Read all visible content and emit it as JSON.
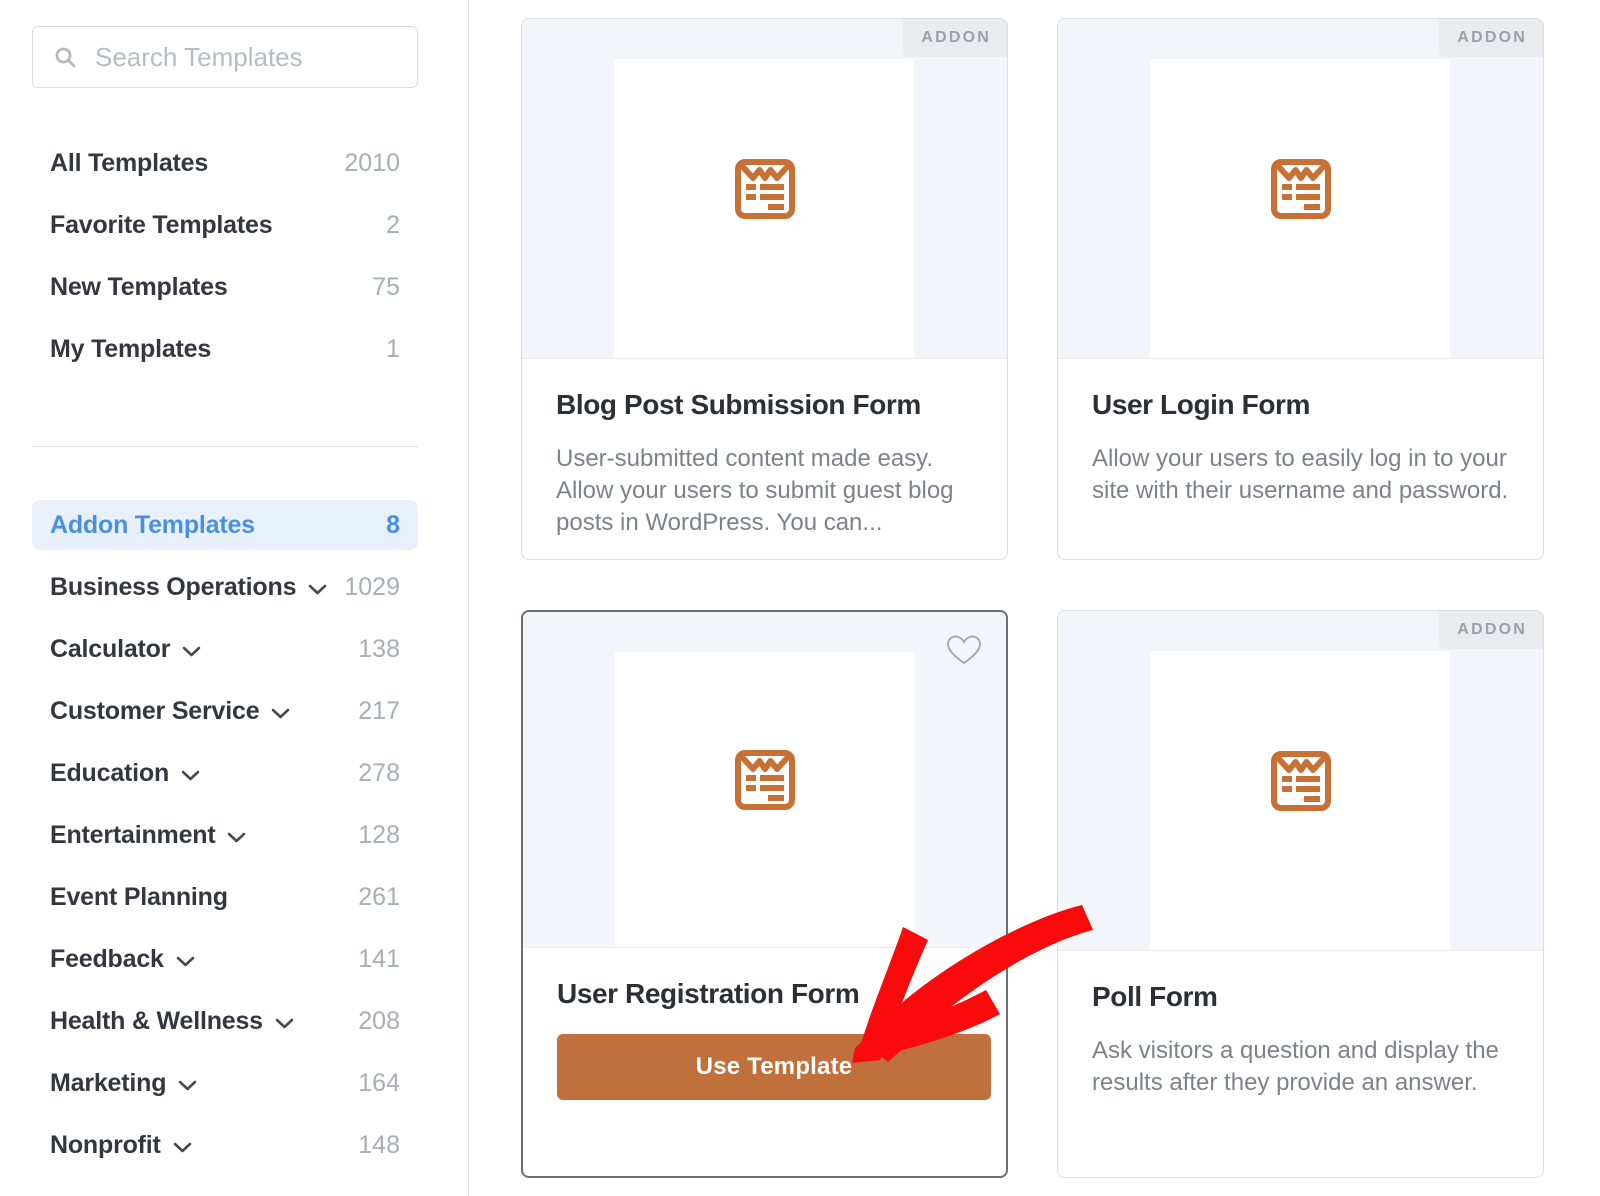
{
  "sidebar": {
    "search": {
      "placeholder": "Search Templates",
      "value": "",
      "icon": "search-icon"
    },
    "nav": [
      {
        "label": "All Templates",
        "count": "2010"
      },
      {
        "label": "Favorite Templates",
        "count": "2"
      },
      {
        "label": "New Templates",
        "count": "75"
      },
      {
        "label": "My Templates",
        "count": "1"
      }
    ],
    "categories": [
      {
        "label": "Addon Templates",
        "count": "8",
        "chevron": false,
        "active": true
      },
      {
        "label": "Business Operations",
        "count": "1029",
        "chevron": true,
        "active": false
      },
      {
        "label": "Calculator",
        "count": "138",
        "chevron": true,
        "active": false
      },
      {
        "label": "Customer Service",
        "count": "217",
        "chevron": true,
        "active": false
      },
      {
        "label": "Education",
        "count": "278",
        "chevron": true,
        "active": false
      },
      {
        "label": "Entertainment",
        "count": "128",
        "chevron": true,
        "active": false
      },
      {
        "label": "Event Planning",
        "count": "261",
        "chevron": false,
        "active": false
      },
      {
        "label": "Feedback",
        "count": "141",
        "chevron": true,
        "active": false
      },
      {
        "label": "Health & Wellness",
        "count": "208",
        "chevron": true,
        "active": false
      },
      {
        "label": "Marketing",
        "count": "164",
        "chevron": true,
        "active": false
      },
      {
        "label": "Nonprofit",
        "count": "148",
        "chevron": true,
        "active": false
      }
    ]
  },
  "templates": [
    {
      "title": "Blog Post Submission Form",
      "description": "User-submitted content made easy. Allow your users to submit guest blog posts in WordPress. You can...",
      "badge": "ADDON",
      "has_badge": true,
      "favorited": false,
      "selected": false,
      "icon": "form-document-icon"
    },
    {
      "title": "User Login Form",
      "description": "Allow your users to easily log in to your site with their username and password.",
      "badge": "ADDON",
      "has_badge": true,
      "favorited": false,
      "selected": false,
      "icon": "form-document-icon"
    },
    {
      "title": "User Registration Form",
      "description": "",
      "badge": "",
      "has_badge": false,
      "favorited": false,
      "selected": true,
      "icon": "form-document-icon",
      "button_label": "Use Template"
    },
    {
      "title": "Poll Form",
      "description": "Ask visitors a question and display the results after they provide an answer.",
      "badge": "ADDON",
      "has_badge": true,
      "favorited": false,
      "selected": false,
      "icon": "form-document-icon"
    }
  ],
  "annotation": {
    "type": "arrow",
    "color": "#fa0a0a",
    "points_to": "Use Template"
  },
  "colors": {
    "accent_orange": "#c87137",
    "button_orange": "#c0703b",
    "active_blue": "#4a90e2",
    "active_blue_bg": "#e7f0fb",
    "preview_bg": "#f2f6fb",
    "badge_bg": "#e8ecef",
    "annotation_red": "#fa0a0a"
  }
}
